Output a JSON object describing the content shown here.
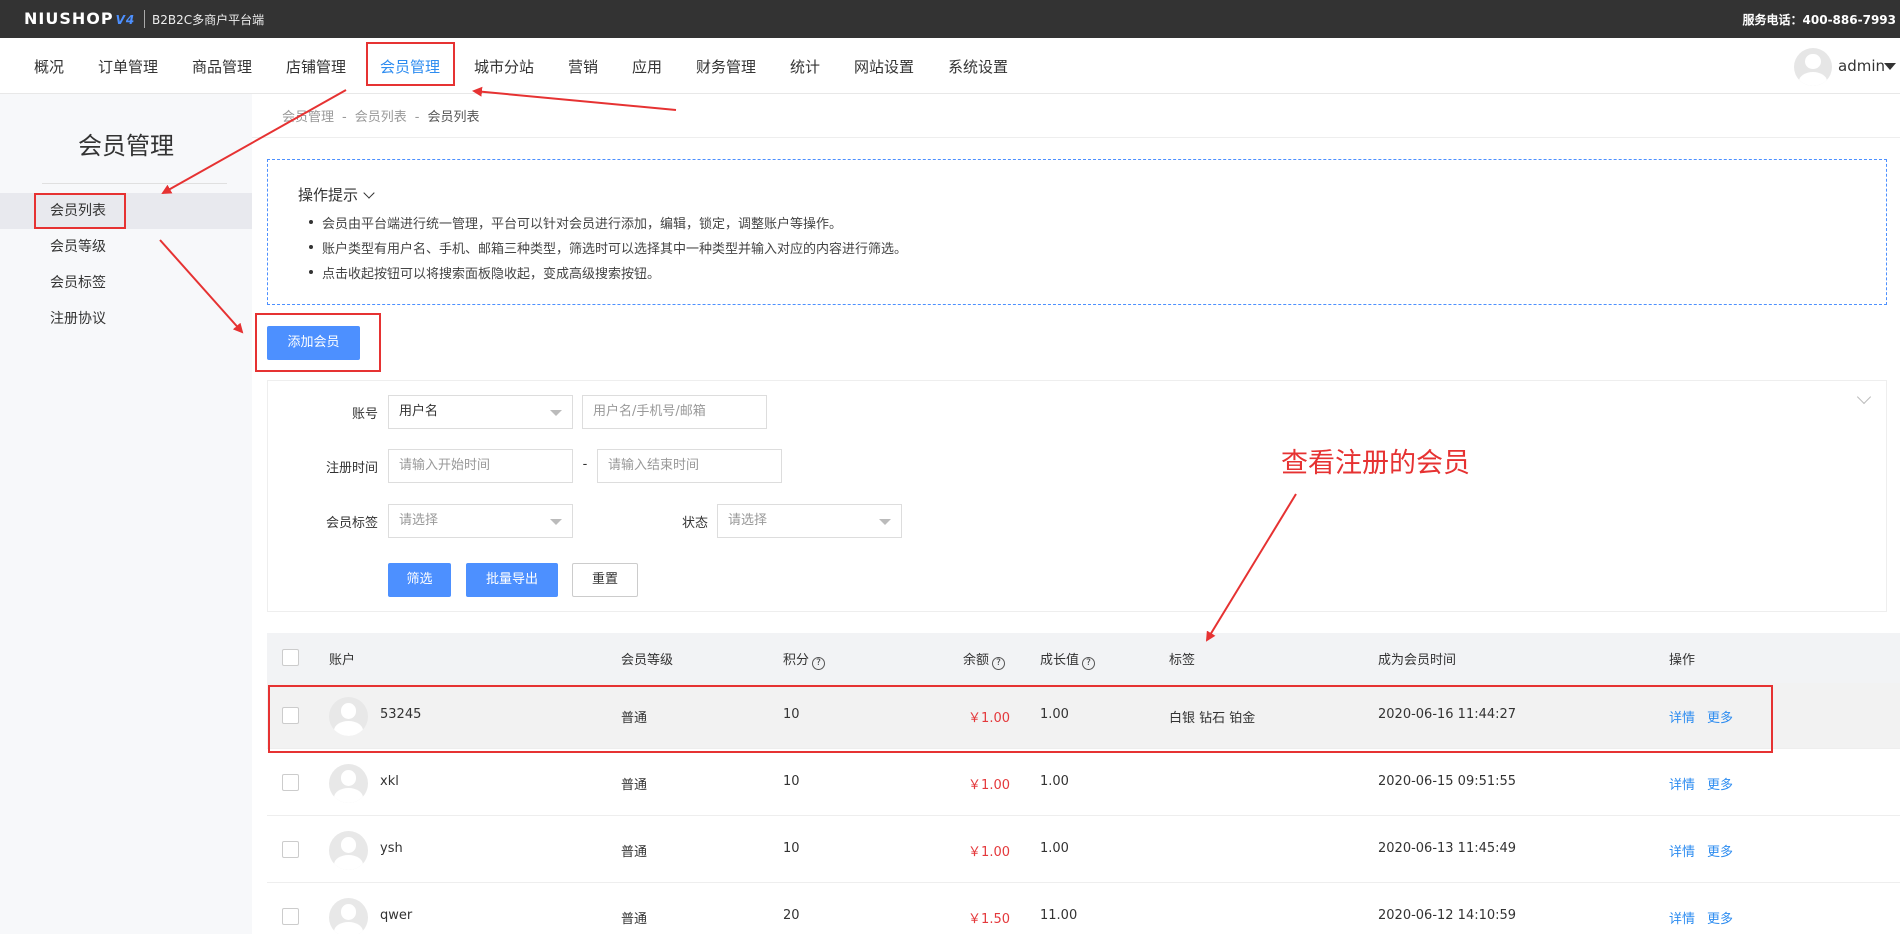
{
  "topbar": {
    "logo": "NIUSHOP",
    "logo_version": "V4",
    "subtitle": "B2B2C多商户平台端",
    "service_phone": "服务电话：400-886-7993"
  },
  "nav": {
    "items": [
      "概况",
      "订单管理",
      "商品管理",
      "店铺管理",
      "会员管理",
      "城市分站",
      "营销",
      "应用",
      "财务管理",
      "统计",
      "网站设置",
      "系统设置"
    ],
    "active_index": 4,
    "user": "admin"
  },
  "sidebar": {
    "title": "会员管理",
    "items": [
      "会员列表",
      "会员等级",
      "会员标签",
      "注册协议"
    ],
    "active_index": 0
  },
  "breadcrumb": {
    "items": [
      "会员管理",
      "会员列表",
      "会员列表"
    ],
    "separator": "-"
  },
  "tips": {
    "title": "操作提示",
    "items": [
      "会员由平台端进行统一管理，平台可以针对会员进行添加，编辑，锁定，调整账户等操作。",
      "账户类型有用户名、手机、邮箱三种类型，筛选时可以选择其中一种类型并输入对应的内容进行筛选。",
      "点击收起按钮可以将搜索面板隐收起，变成高级搜索按钮。"
    ]
  },
  "add_button": "添加会员",
  "filter": {
    "account_label": "账号",
    "account_type": "用户名",
    "account_placeholder": "用户名/手机号/邮箱",
    "regtime_label": "注册时间",
    "start_placeholder": "请输入开始时间",
    "range_sep": "-",
    "end_placeholder": "请输入结束时间",
    "tag_label": "会员标签",
    "tag_placeholder": "请选择",
    "status_label": "状态",
    "status_placeholder": "请选择",
    "btn_filter": "筛选",
    "btn_export": "批量导出",
    "btn_reset": "重置"
  },
  "table": {
    "headers": {
      "account": "账户",
      "level": "会员等级",
      "points": "积分",
      "balance": "余额",
      "growth": "成长值",
      "tags": "标签",
      "join_time": "成为会员时间",
      "actions": "操作"
    },
    "help_glyph": "?",
    "rows": [
      {
        "account": "53245",
        "level": "普通",
        "points": "10",
        "balance": "￥1.00",
        "growth": "1.00",
        "tags": "白银 钻石 铂金",
        "join_time": "2020-06-16 11:44:27",
        "detail": "详情",
        "more": "更多"
      },
      {
        "account": "xkl",
        "level": "普通",
        "points": "10",
        "balance": "￥1.00",
        "growth": "1.00",
        "tags": "",
        "join_time": "2020-06-15 09:51:55",
        "detail": "详情",
        "more": "更多"
      },
      {
        "account": "ysh",
        "level": "普通",
        "points": "10",
        "balance": "￥1.00",
        "growth": "1.00",
        "tags": "",
        "join_time": "2020-06-13 11:45:49",
        "detail": "详情",
        "more": "更多"
      },
      {
        "account": "qwer",
        "level": "普通",
        "points": "20",
        "balance": "￥1.50",
        "growth": "11.00",
        "tags": "",
        "join_time": "2020-06-12 14:10:59",
        "detail": "详情",
        "more": "更多"
      }
    ]
  },
  "annotation": {
    "text": "查看注册的会员",
    "color": "#e63232"
  },
  "colors": {
    "accent": "#4d90ff",
    "link": "#2d8cf0",
    "money": "#e4393c",
    "topbar": "#333333"
  }
}
